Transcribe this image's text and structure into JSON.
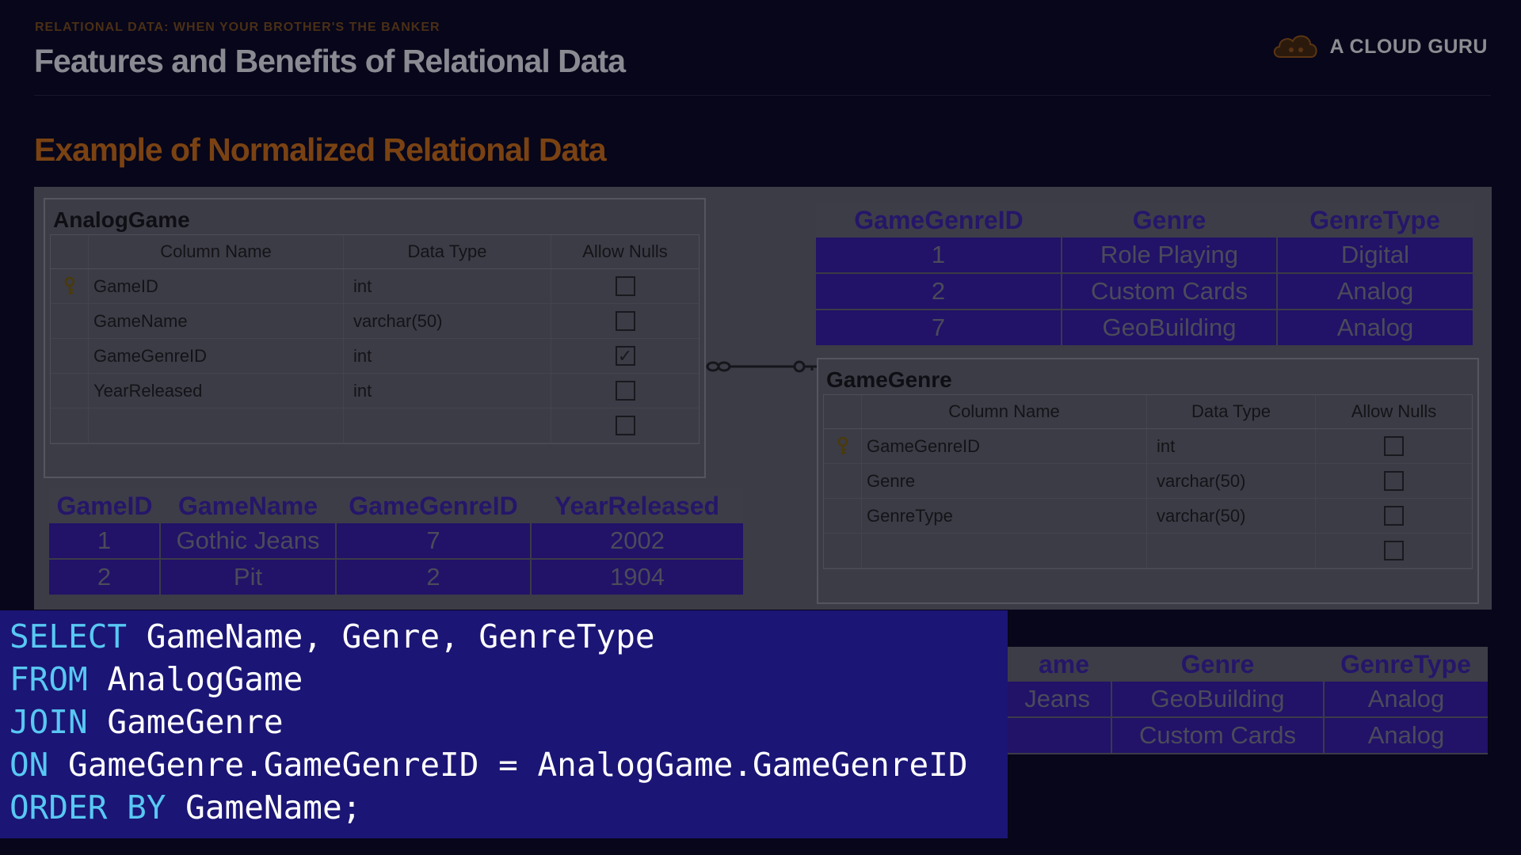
{
  "header": {
    "kicker": "RELATIONAL DATA: WHEN YOUR BROTHER'S THE BANKER",
    "title": "Features and Benefits of Relational Data",
    "brand": "A CLOUD GURU",
    "subtitle": "Example of Normalized Relational Data"
  },
  "analog_game_designer": {
    "title": "AnalogGame",
    "headers": [
      "Column Name",
      "Data Type",
      "Allow Nulls"
    ],
    "rows": [
      {
        "name": "GameID",
        "type": "int",
        "allow_nulls": false,
        "primary_key": true
      },
      {
        "name": "GameName",
        "type": "varchar(50)",
        "allow_nulls": false,
        "primary_key": false
      },
      {
        "name": "GameGenreID",
        "type": "int",
        "allow_nulls": true,
        "primary_key": false
      },
      {
        "name": "YearReleased",
        "type": "int",
        "allow_nulls": false,
        "primary_key": false
      },
      {
        "name": "",
        "type": "",
        "allow_nulls": false,
        "primary_key": false
      }
    ]
  },
  "game_genre_designer": {
    "title": "GameGenre",
    "headers": [
      "Column Name",
      "Data Type",
      "Allow Nulls"
    ],
    "rows": [
      {
        "name": "GameGenreID",
        "type": "int",
        "allow_nulls": false,
        "primary_key": true
      },
      {
        "name": "Genre",
        "type": "varchar(50)",
        "allow_nulls": false,
        "primary_key": false
      },
      {
        "name": "GenreType",
        "type": "varchar(50)",
        "allow_nulls": false,
        "primary_key": false
      },
      {
        "name": "",
        "type": "",
        "allow_nulls": false,
        "primary_key": false
      }
    ]
  },
  "genre_table": {
    "headers": [
      "GameGenreID",
      "Genre",
      "GenreType"
    ],
    "rows": [
      [
        "1",
        "Role Playing",
        "Digital"
      ],
      [
        "2",
        "Custom Cards",
        "Analog"
      ],
      [
        "7",
        "GeoBuilding",
        "Analog"
      ]
    ]
  },
  "game_table": {
    "headers": [
      "GameID",
      "GameName",
      "GameGenreID",
      "YearReleased"
    ],
    "rows": [
      [
        "1",
        "Gothic Jeans",
        "7",
        "2002"
      ],
      [
        "2",
        "Pit",
        "2",
        "1904"
      ]
    ]
  },
  "result_table": {
    "headers": [
      "ame",
      "Genre",
      "GenreType"
    ],
    "rows": [
      [
        "Jeans",
        "GeoBuilding",
        "Analog"
      ],
      [
        "",
        "Custom Cards",
        "Analog"
      ]
    ]
  },
  "sql": {
    "select_kw": "SELECT",
    "select_cols": " GameName, Genre, GenreType",
    "from_kw": "FROM",
    "from_table": " AnalogGame",
    "join_kw": "JOIN",
    "join_table": " GameGenre",
    "on_kw": "ON",
    "on_cond": " GameGenre.GameGenreID = AnalogGame.GameGenreID",
    "order_kw": "ORDER BY",
    "order_col": " GameName;"
  },
  "colors": {
    "background": "#07061a",
    "accent_orange": "#7a4212",
    "sql_panel": "#1b1575",
    "sql_keyword": "#58c8f3",
    "data_row": "#221268"
  }
}
